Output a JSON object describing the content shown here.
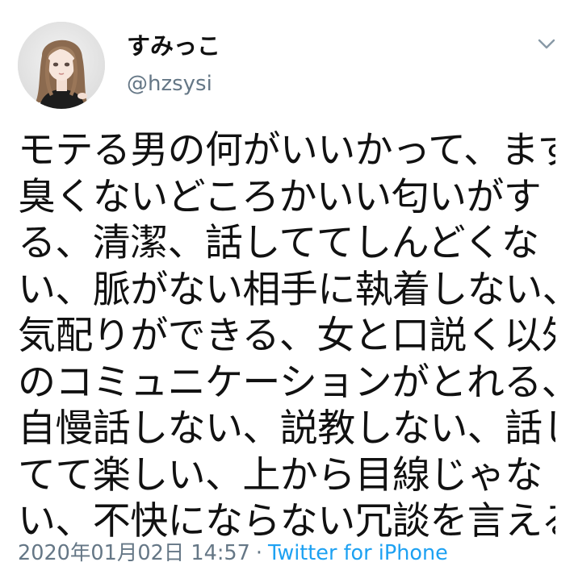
{
  "profile": {
    "display_name": "すみっこ",
    "handle": "@hzsysi",
    "avatar_icon": "user-avatar-portrait"
  },
  "menu": {
    "icon": "chevron-down-icon"
  },
  "tweet": {
    "lines": [
      "モテる男の何がいいかって、まず",
      "臭くないどころかいい匂いがす",
      "る、清潔、話しててしんどくな",
      "い、脈がない相手に執着しない、",
      "気配りができる、女と口説く以外",
      "のコミュニケーションがとれる、",
      "自慢話しない、説教しない、話し",
      "てて楽しい、上から目線じゃな",
      "い、不快にならない冗談を言える"
    ],
    "timestamp": "2020年01月02日 14:57",
    "separator": "·",
    "source": "Twitter for iPhone"
  },
  "colors": {
    "text": "#111111",
    "secondary": "#657786",
    "link": "#1da1f2"
  }
}
